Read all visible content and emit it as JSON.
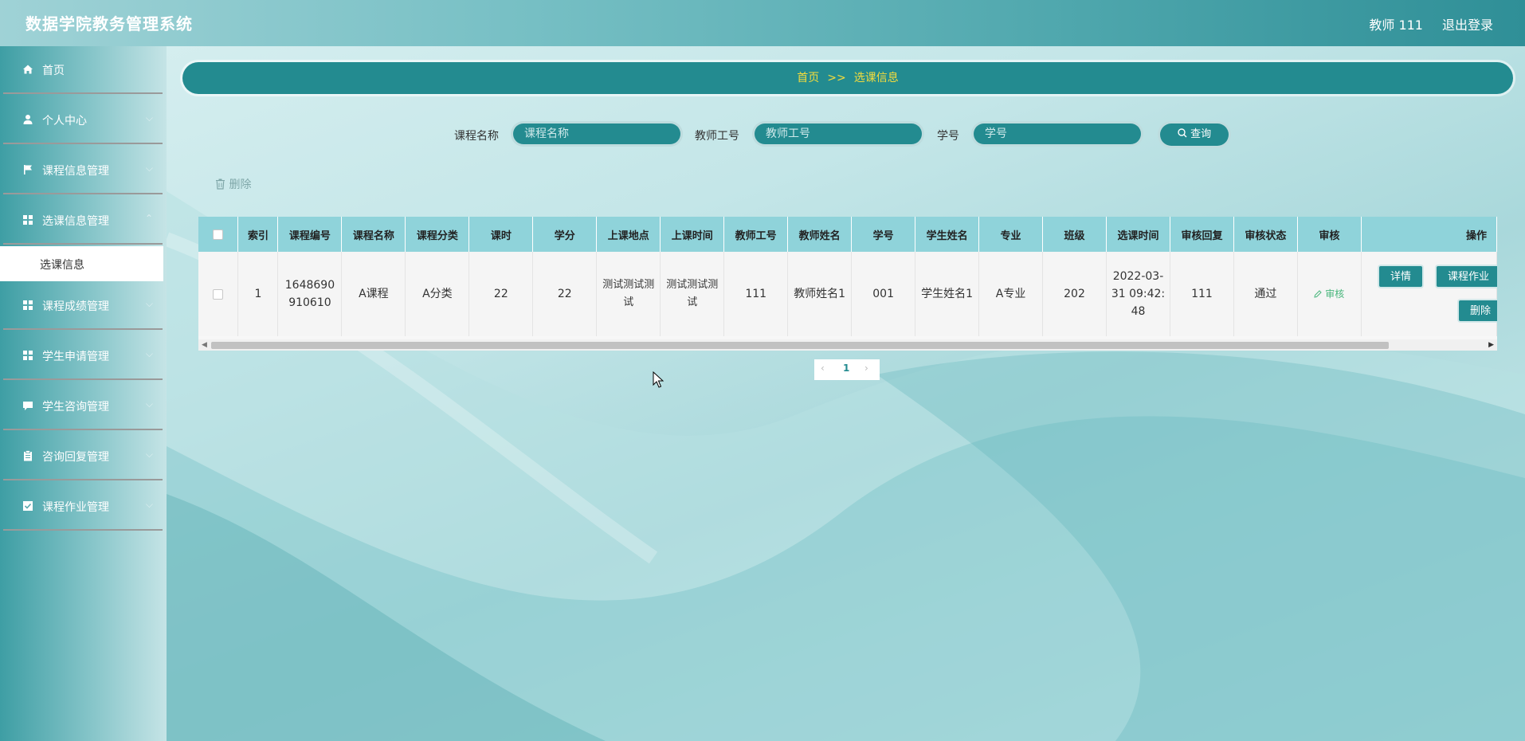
{
  "header": {
    "app_title": "数据学院教务管理系统",
    "user_label": "教师 111",
    "logout_label": "退出登录"
  },
  "sidebar": {
    "items": [
      {
        "label": "首页",
        "icon": "home-icon"
      },
      {
        "label": "个人中心",
        "icon": "user-icon"
      },
      {
        "label": "课程信息管理",
        "icon": "flag-icon"
      },
      {
        "label": "选课信息管理",
        "icon": "grid-icon"
      },
      {
        "label": "课程成绩管理",
        "icon": "grid-icon"
      },
      {
        "label": "学生申请管理",
        "icon": "grid-icon"
      },
      {
        "label": "学生咨询管理",
        "icon": "chat-icon"
      },
      {
        "label": "咨询回复管理",
        "icon": "clipboard-icon"
      },
      {
        "label": "课程作业管理",
        "icon": "checkbox-icon"
      }
    ],
    "active_sub": "选课信息"
  },
  "breadcrumb": {
    "home": "首页",
    "separator": ">>",
    "current": "选课信息"
  },
  "search": {
    "course_name_label": "课程名称",
    "course_name_placeholder": "课程名称",
    "teacher_id_label": "教师工号",
    "teacher_id_placeholder": "教师工号",
    "student_id_label": "学号",
    "student_id_placeholder": "学号",
    "query_label": "查询"
  },
  "toolbar": {
    "delete_label": "删除"
  },
  "table": {
    "columns": [
      "索引",
      "课程编号",
      "课程名称",
      "课程分类",
      "课时",
      "学分",
      "上课地点",
      "上课时间",
      "教师工号",
      "教师姓名",
      "学号",
      "学生姓名",
      "专业",
      "班级",
      "选课时间",
      "审核回复",
      "审核状态",
      "审核",
      "操作"
    ],
    "rows": [
      {
        "index": "1",
        "course_no": "1648690910610",
        "course_name": "A课程",
        "category": "A分类",
        "hours": "22",
        "credits": "22",
        "location": "测试测试测试",
        "time": "测试测试测试",
        "teacher_id": "111",
        "teacher_name": "教师姓名1",
        "student_id": "001",
        "student_name": "学生姓名1",
        "major": "A专业",
        "class": "202",
        "select_time": "2022-03-31 09:42:48",
        "audit_reply": "111",
        "audit_status": "通过",
        "audit_action": "审核",
        "actions": {
          "detail": "详情",
          "homework": "课程作业",
          "delete": "删除"
        }
      }
    ]
  },
  "pagination": {
    "prev": "‹",
    "current_page": "1",
    "next": "›"
  },
  "colors": {
    "primary": "#238b90",
    "header_cell": "#8fd3da",
    "breadcrumb_text": "#f4dc3c",
    "audit_link": "#48b67c"
  }
}
